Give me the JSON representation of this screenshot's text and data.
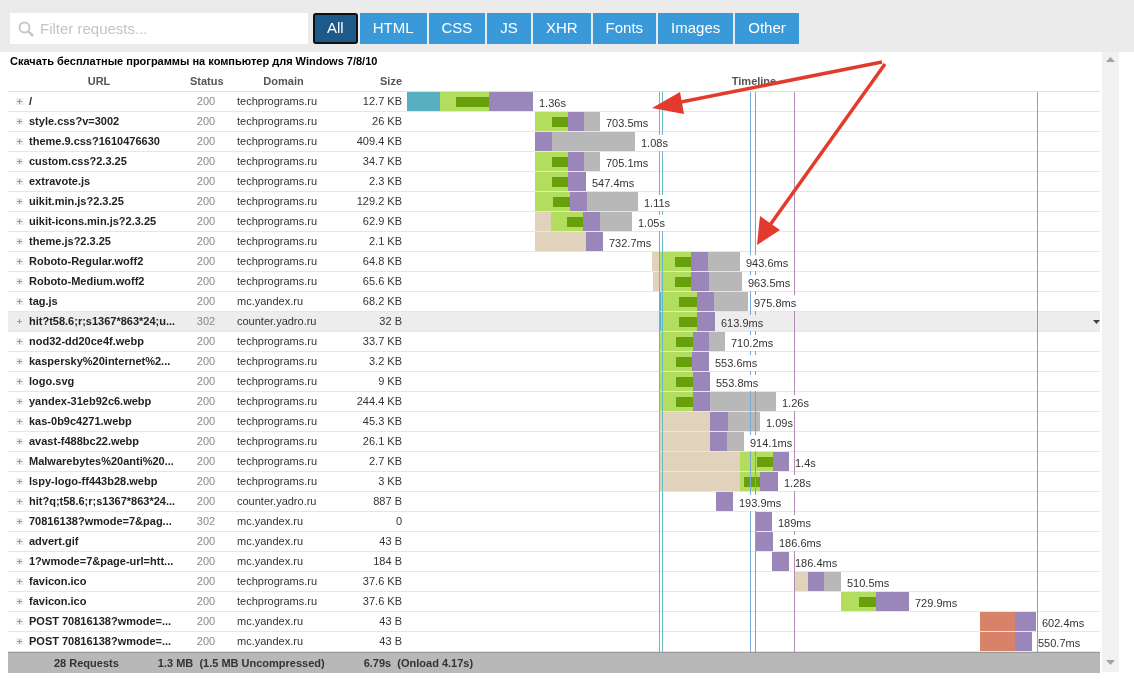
{
  "filter": {
    "placeholder": "Filter requests..."
  },
  "tabs": [
    {
      "label": "All",
      "selected": true
    },
    {
      "label": "HTML",
      "selected": false
    },
    {
      "label": "CSS",
      "selected": false
    },
    {
      "label": "JS",
      "selected": false
    },
    {
      "label": "XHR",
      "selected": false
    },
    {
      "label": "Fonts",
      "selected": false
    },
    {
      "label": "Images",
      "selected": false
    },
    {
      "label": "Other",
      "selected": false
    }
  ],
  "page_title": "Скачать бесплатные программы на компьютер для Windows 7/8/10",
  "table": {
    "columns": [
      "URL",
      "Status",
      "Domain",
      "Size",
      "Timeline"
    ],
    "rows": [
      {
        "url": "/",
        "status": "200",
        "domain": "techprograms.ru",
        "size": "12.7 KB",
        "time": "1.36s",
        "selected": false
      },
      {
        "url": "style.css?v=3002",
        "status": "200",
        "domain": "techprograms.ru",
        "size": "26 KB",
        "time": "703.5ms",
        "selected": false
      },
      {
        "url": "theme.9.css?1610476630",
        "status": "200",
        "domain": "techprograms.ru",
        "size": "409.4 KB",
        "time": "1.08s",
        "selected": false
      },
      {
        "url": "custom.css?2.3.25",
        "status": "200",
        "domain": "techprograms.ru",
        "size": "34.7 KB",
        "time": "705.1ms",
        "selected": false
      },
      {
        "url": "extravote.js",
        "status": "200",
        "domain": "techprograms.ru",
        "size": "2.3 KB",
        "time": "547.4ms",
        "selected": false
      },
      {
        "url": "uikit.min.js?2.3.25",
        "status": "200",
        "domain": "techprograms.ru",
        "size": "129.2 KB",
        "time": "1.11s",
        "selected": false
      },
      {
        "url": "uikit-icons.min.js?2.3.25",
        "status": "200",
        "domain": "techprograms.ru",
        "size": "62.9 KB",
        "time": "1.05s",
        "selected": false
      },
      {
        "url": "theme.js?2.3.25",
        "status": "200",
        "domain": "techprograms.ru",
        "size": "2.1 KB",
        "time": "732.7ms",
        "selected": false
      },
      {
        "url": "Roboto-Regular.woff2",
        "status": "200",
        "domain": "techprograms.ru",
        "size": "64.8 KB",
        "time": "943.6ms",
        "selected": false
      },
      {
        "url": "Roboto-Medium.woff2",
        "status": "200",
        "domain": "techprograms.ru",
        "size": "65.6 KB",
        "time": "963.5ms",
        "selected": false
      },
      {
        "url": "tag.js",
        "status": "200",
        "domain": "mc.yandex.ru",
        "size": "68.2 KB",
        "time": "975.8ms",
        "selected": false
      },
      {
        "url": "hit?t58.6;r;s1367*863*24;u...",
        "status": "302",
        "domain": "counter.yadro.ru",
        "size": "32 B",
        "time": "613.9ms",
        "selected": true
      },
      {
        "url": "nod32-dd20ce4f.webp",
        "status": "200",
        "domain": "techprograms.ru",
        "size": "33.7 KB",
        "time": "710.2ms",
        "selected": false
      },
      {
        "url": "kaspersky%20internet%2...",
        "status": "200",
        "domain": "techprograms.ru",
        "size": "3.2 KB",
        "time": "553.6ms",
        "selected": false
      },
      {
        "url": "logo.svg",
        "status": "200",
        "domain": "techprograms.ru",
        "size": "9 KB",
        "time": "553.8ms",
        "selected": false
      },
      {
        "url": "yandex-31eb92c6.webp",
        "status": "200",
        "domain": "techprograms.ru",
        "size": "244.4 KB",
        "time": "1.26s",
        "selected": false
      },
      {
        "url": "kas-0b9c4271.webp",
        "status": "200",
        "domain": "techprograms.ru",
        "size": "45.3 KB",
        "time": "1.09s",
        "selected": false
      },
      {
        "url": "avast-f488bc22.webp",
        "status": "200",
        "domain": "techprograms.ru",
        "size": "26.1 KB",
        "time": "914.1ms",
        "selected": false
      },
      {
        "url": "Malwarebytes%20anti%20...",
        "status": "200",
        "domain": "techprograms.ru",
        "size": "2.7 KB",
        "time": "1.4s",
        "selected": false
      },
      {
        "url": "lspy-logo-ff443b28.webp",
        "status": "200",
        "domain": "techprograms.ru",
        "size": "3 KB",
        "time": "1.28s",
        "selected": false
      },
      {
        "url": "hit?q;t58.6;r;s1367*863*24...",
        "status": "200",
        "domain": "counter.yadro.ru",
        "size": "887 B",
        "time": "193.9ms",
        "selected": false
      },
      {
        "url": "70816138?wmode=7&pag...",
        "status": "302",
        "domain": "mc.yandex.ru",
        "size": "0",
        "time": "189ms",
        "selected": false
      },
      {
        "url": "advert.gif",
        "status": "200",
        "domain": "mc.yandex.ru",
        "size": "43 B",
        "time": "186.6ms",
        "selected": false
      },
      {
        "url": "1?wmode=7&page-url=htt...",
        "status": "200",
        "domain": "mc.yandex.ru",
        "size": "184 B",
        "time": "186.4ms",
        "selected": false
      },
      {
        "url": "favicon.ico",
        "status": "200",
        "domain": "techprograms.ru",
        "size": "37.6 KB",
        "time": "510.5ms",
        "selected": false
      },
      {
        "url": "favicon.ico",
        "status": "200",
        "domain": "techprograms.ru",
        "size": "37.6 KB",
        "time": "729.9ms",
        "selected": false
      },
      {
        "url": "POST 70816138?wmode=...",
        "status": "200",
        "domain": "mc.yandex.ru",
        "size": "43 B",
        "time": "602.4ms",
        "selected": false
      },
      {
        "url": "POST 70816138?wmode=...",
        "status": "200",
        "domain": "mc.yandex.ru",
        "size": "43 B",
        "time": "550.7ms",
        "selected": false
      }
    ]
  },
  "footer": {
    "requests": "28 Requests",
    "size": "1.3 MB  (1.5 MB Uncompressed)",
    "time": "6.79s  (Onload 4.17s)"
  }
}
